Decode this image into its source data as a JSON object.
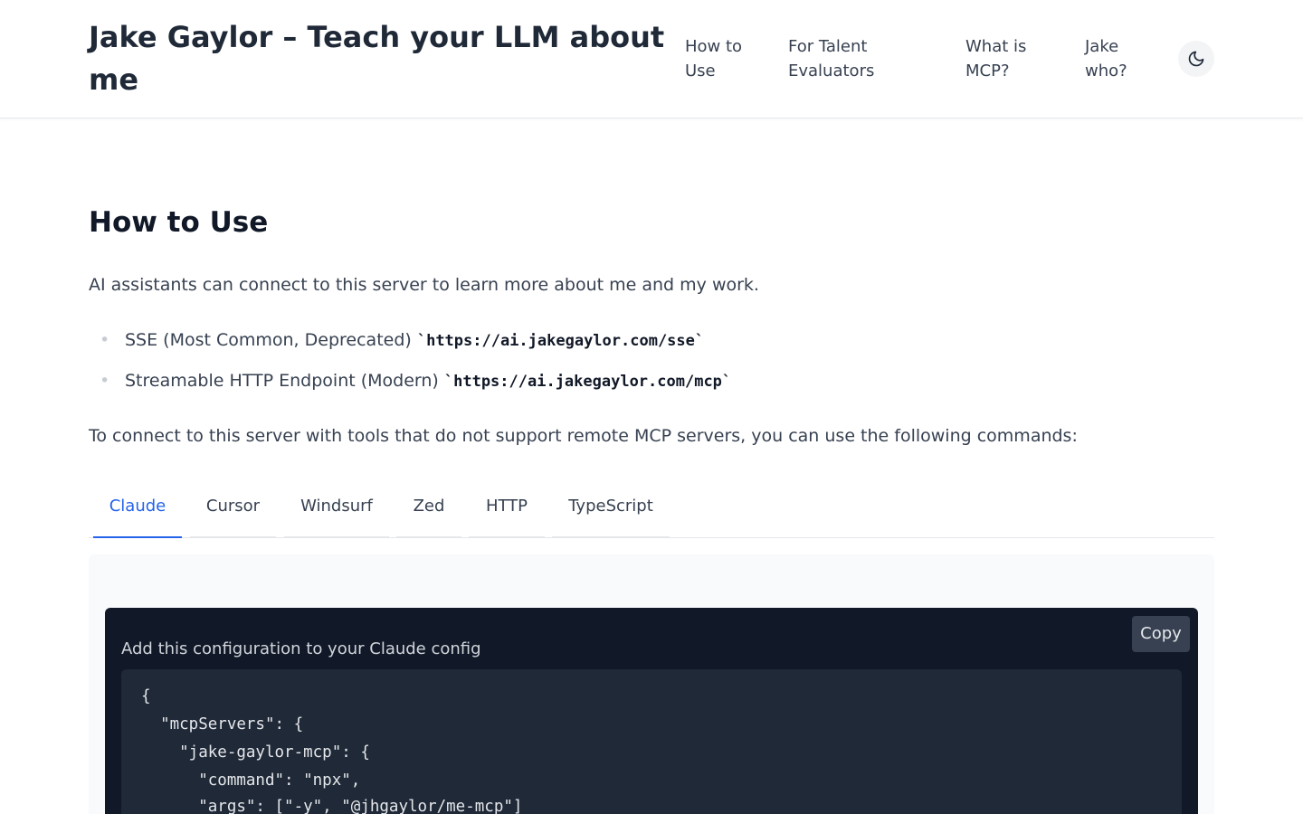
{
  "header": {
    "title": "Jake Gaylor – Teach your LLM about me",
    "nav": [
      {
        "label": "How to Use"
      },
      {
        "label": "For Talent Evaluators"
      },
      {
        "label": "What is MCP?"
      },
      {
        "label": "Jake who?"
      }
    ],
    "theme_toggle_icon": "moon-icon"
  },
  "main": {
    "title": "How to Use",
    "intro": "AI assistants can connect to this server to learn more about me and my work.",
    "endpoints": [
      {
        "label": "SSE (Most Common, Deprecated) ",
        "url": "`https://ai.jakegaylor.com/sse`"
      },
      {
        "label": "Streamable HTTP Endpoint (Modern) ",
        "url": "`https://ai.jakegaylor.com/mcp`"
      }
    ],
    "connect_text": "To connect to this server with tools that do not support remote MCP servers, you can use the following commands:",
    "tabs": [
      {
        "label": "Claude"
      },
      {
        "label": "Cursor"
      },
      {
        "label": "Windsurf"
      },
      {
        "label": "Zed"
      },
      {
        "label": "HTTP"
      },
      {
        "label": "TypeScript"
      }
    ],
    "active_tab": "Claude",
    "panel": {
      "copy_label": "Copy",
      "config_label": "Add this configuration to your Claude config",
      "code_lines": [
        "{",
        "  \"mcpServers\": {",
        "    \"jake-gaylor-mcp\": {",
        "      \"command\": \"npx\",",
        "      \"args\": [\"-y\", \"@jhgaylor/me-mcp\"]"
      ]
    }
  },
  "colors": {
    "accent": "#2563eb",
    "code_bg": "#111827",
    "code_inner_bg": "#1f2937",
    "panel_bg": "#f8fafc"
  }
}
